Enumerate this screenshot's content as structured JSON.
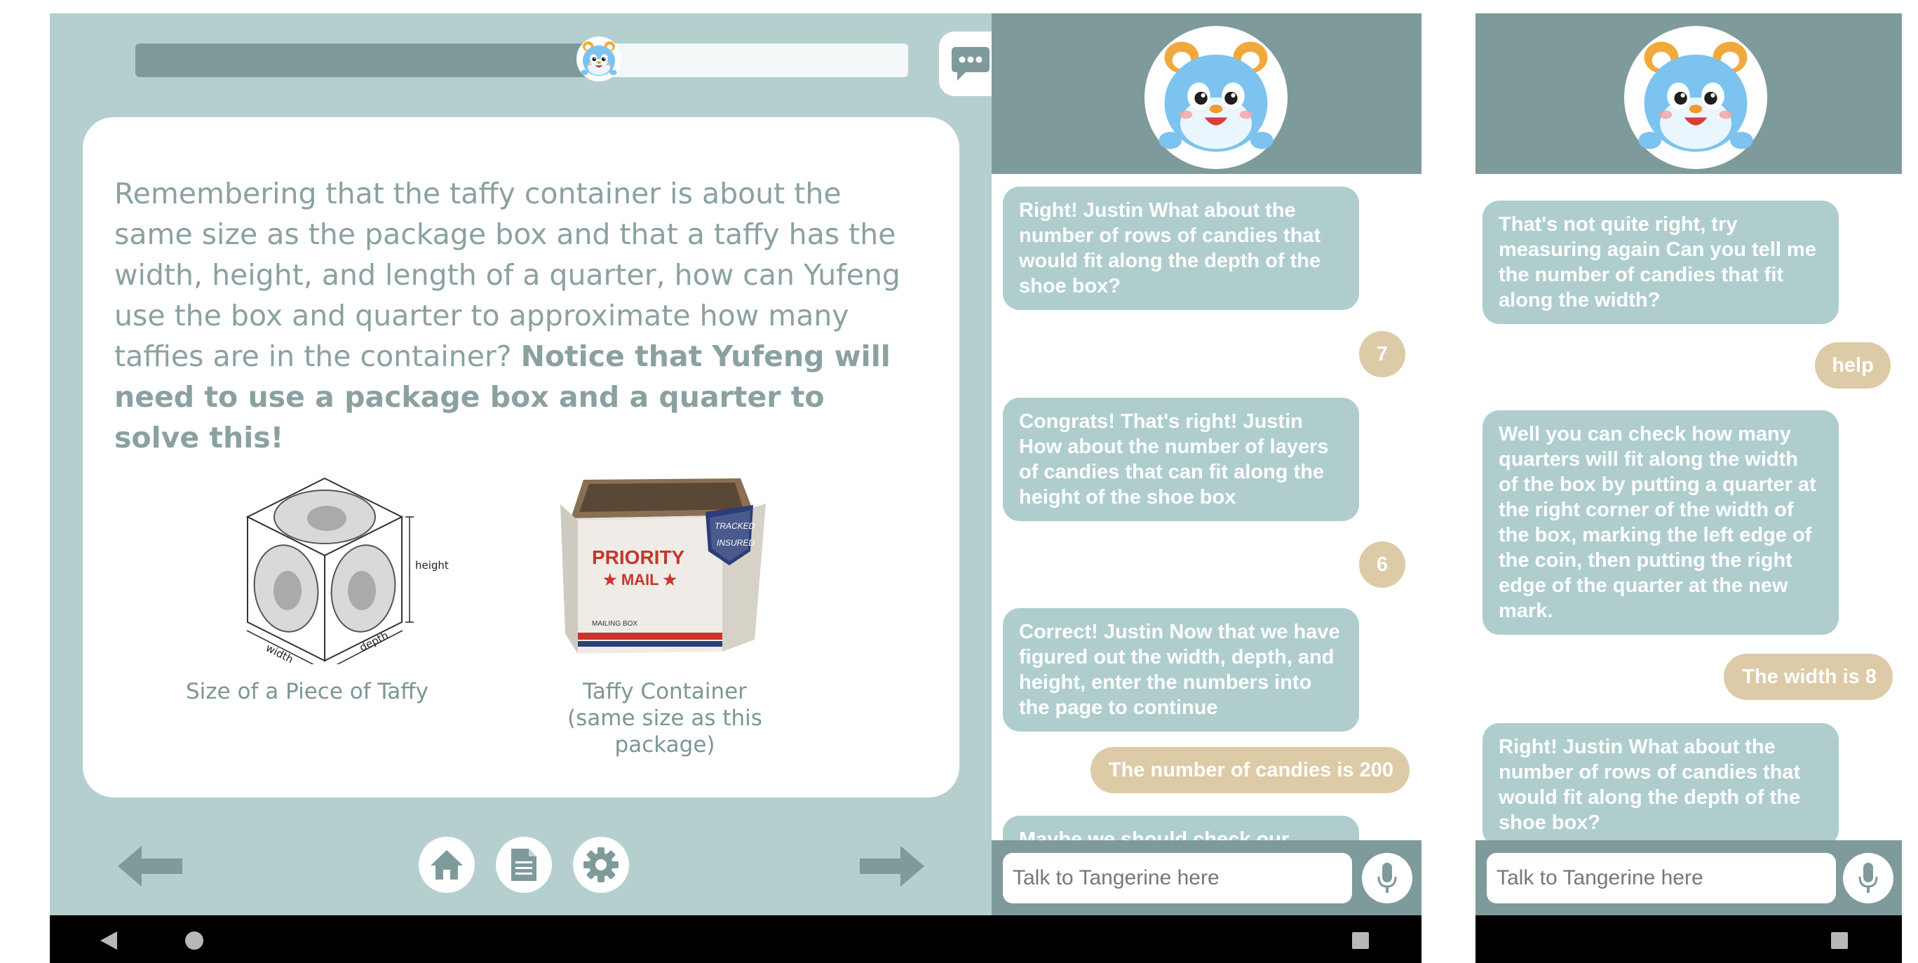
{
  "lesson": {
    "progress_fraction": 0.6,
    "question_text": "Remembering that the taffy container is about the same size as the package box and that a taffy has the width, height, and length of a quarter, how can Yufeng use the box and quarter to approximate how many taffies are in the container? ",
    "question_emphasis": "Notice that Yufeng will need to use a package box and a quarter to solve this!",
    "figure_quarter_caption": "Size of a Piece of Taffy",
    "figure_quarter_labels": {
      "height": "height",
      "width": "width",
      "depth": "depth"
    },
    "figure_box_caption_line1": "Taffy Container",
    "figure_box_caption_line2": "(same size as this package)",
    "box_print": {
      "brand_line1": "PRIORITY",
      "brand_line2": "★ MAIL ★",
      "tag_line1": "TRACKED",
      "tag_line2": "INSURED",
      "small": "MAILING BOX"
    },
    "icons": {
      "back": "arrow-left-icon",
      "home": "home-icon",
      "notes": "document-icon",
      "settings": "gear-icon",
      "next": "arrow-right-icon",
      "chat": "chat-bubble-icon"
    }
  },
  "chat_left": {
    "messages": [
      {
        "role": "bot",
        "text": "Right! Justin What about the number of rows of candies that would fit along the depth of the shoe box?"
      },
      {
        "role": "user",
        "text": "7"
      },
      {
        "role": "bot",
        "text": "Congrats! That's right! Justin How about the number of layers of candies that can fit along the height of the shoe box"
      },
      {
        "role": "user",
        "text": "6"
      },
      {
        "role": "bot",
        "text": "Correct! Justin Now that we have figured out the width, depth, and height, enter the numbers into the page to continue"
      },
      {
        "role": "user",
        "text": "The number of candies is 200"
      },
      {
        "role": "bot",
        "text": "Maybe we should check our"
      }
    ],
    "input_placeholder": "Talk to Tangerine here"
  },
  "chat_right": {
    "messages": [
      {
        "role": "bot",
        "text": "That's not quite right, try measuring again Can you tell me the number of candies that fit along the width?"
      },
      {
        "role": "user",
        "text": "help"
      },
      {
        "role": "bot",
        "text": "Well you can check how many quarters will fit along the width of the box by putting a quarter at the right corner of the width of the box, marking the left edge of the coin, then putting the right edge of the quarter at the new mark."
      },
      {
        "role": "user",
        "text": "The width is 8"
      },
      {
        "role": "bot",
        "text": "Right! Justin What about the number of rows of candies that would fit along the depth of the shoe box?"
      }
    ],
    "input_placeholder": "Talk to Tangerine here"
  },
  "colors": {
    "lesson_bg": "#b5cfcf",
    "dark_teal": "#7f9a9a",
    "bot_bubble": "#afcdcd",
    "user_bubble": "#dccba6",
    "text_gray": "#8ba1a1"
  }
}
